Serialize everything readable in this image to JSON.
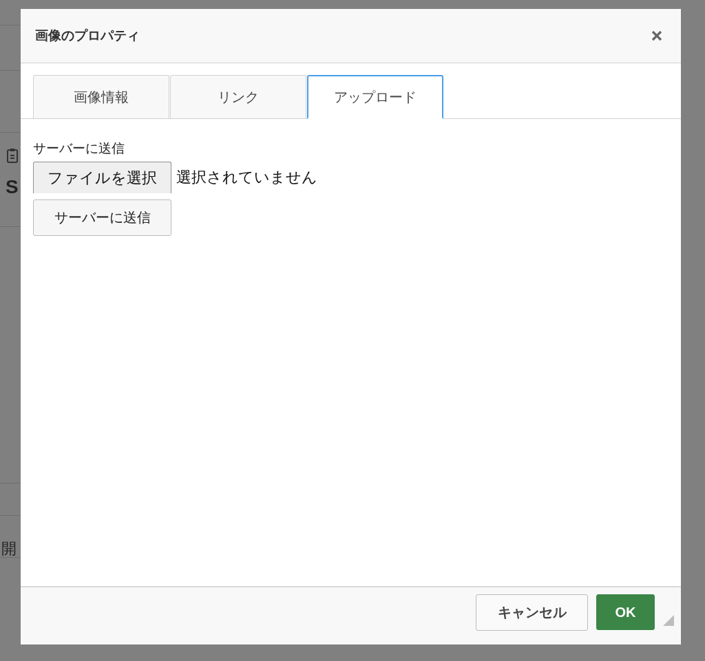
{
  "background": {
    "letter": "S",
    "word": "開"
  },
  "dialog": {
    "title": "画像のプロパティ",
    "tabs": [
      {
        "label": "画像情報",
        "selected": false
      },
      {
        "label": "リンク",
        "selected": false
      },
      {
        "label": "アップロード",
        "selected": true
      }
    ],
    "upload": {
      "label": "サーバーに送信",
      "choose_button": "ファイルを選択",
      "file_status": "選択されていません",
      "send_button": "サーバーに送信"
    },
    "buttons": [
      {
        "label": "キャンセル",
        "kind": "secondary"
      },
      {
        "label": "OK",
        "kind": "primary"
      }
    ]
  }
}
